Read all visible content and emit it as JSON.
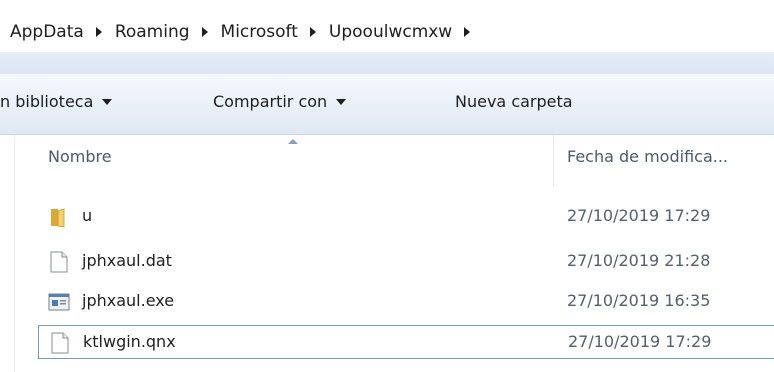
{
  "breadcrumb": [
    "AppData",
    "Roaming",
    "Microsoft",
    "Upooulwcmxw"
  ],
  "toolbar": {
    "library_label": "n biblioteca",
    "share_label": "Compartir con",
    "new_folder_label": "Nueva carpeta"
  },
  "columns": {
    "name": "Nombre",
    "date": "Fecha de modifica..."
  },
  "files": [
    {
      "name": "u",
      "date": "27/10/2019 17:29",
      "icon": "folder-icon"
    },
    {
      "name": "jphxaul.dat",
      "date": "27/10/2019 21:28",
      "icon": "document-icon"
    },
    {
      "name": "jphxaul.exe",
      "date": "27/10/2019 16:35",
      "icon": "executable-icon"
    },
    {
      "name": "ktlwgin.qnx",
      "date": "27/10/2019 17:29",
      "icon": "document-icon"
    }
  ],
  "colors": {
    "toolbar_gradient_top": "#f5f9fd",
    "toolbar_gradient_bottom": "#dfe8f3",
    "focus_border": "#7a9ab8",
    "folder": "#e7c35a"
  }
}
